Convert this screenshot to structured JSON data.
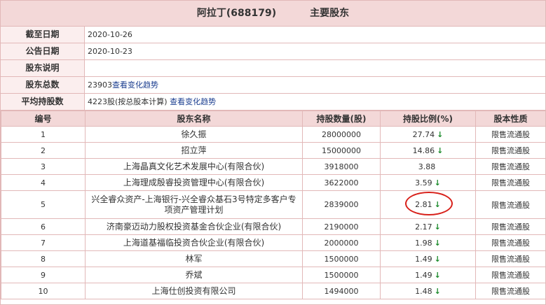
{
  "header": {
    "company": "阿拉丁(688179)",
    "section": "主要股东"
  },
  "info": [
    {
      "label": "截至日期",
      "value": "2020-10-26",
      "link": ""
    },
    {
      "label": "公告日期",
      "value": "2020-10-23",
      "link": ""
    },
    {
      "label": "股东说明",
      "value": "",
      "link": ""
    },
    {
      "label": "股东总数",
      "value": "23903",
      "link": "查看变化趋势"
    },
    {
      "label": "平均持股数",
      "value": "4223股(按总股本计算)",
      "link": "查看变化趋势"
    }
  ],
  "table": {
    "columns": [
      "编号",
      "股东名称",
      "持股数量(股)",
      "持股比例(%)",
      "股本性质"
    ],
    "rows": [
      {
        "no": "1",
        "name": "徐久振",
        "shares": "28000000",
        "pct": "27.74",
        "arrow": "↓",
        "type": "限售流通股"
      },
      {
        "no": "2",
        "name": "招立萍",
        "shares": "15000000",
        "pct": "14.86",
        "arrow": "↓",
        "type": "限售流通股"
      },
      {
        "no": "3",
        "name": "上海晶真文化艺术发展中心(有限合伙)",
        "shares": "3918000",
        "pct": "3.88",
        "arrow": "",
        "type": "限售流通股"
      },
      {
        "no": "4",
        "name": "上海理成殷睿投资管理中心(有限合伙)",
        "shares": "3622000",
        "pct": "3.59",
        "arrow": "↓",
        "type": "限售流通股"
      },
      {
        "no": "5",
        "name": "兴全睿众资产-上海银行-兴全睿众基石3号特定多客户专项资产管理计划",
        "shares": "2839000",
        "pct": "2.81",
        "arrow": "↓",
        "type": "限售流通股"
      },
      {
        "no": "6",
        "name": "济南豪迈动力股权投资基金合伙企业(有限合伙)",
        "shares": "2190000",
        "pct": "2.17",
        "arrow": "↓",
        "type": "限售流通股"
      },
      {
        "no": "7",
        "name": "上海道基福临投资合伙企业(有限合伙)",
        "shares": "2000000",
        "pct": "1.98",
        "arrow": "↓",
        "type": "限售流通股"
      },
      {
        "no": "8",
        "name": "林军",
        "shares": "1500000",
        "pct": "1.49",
        "arrow": "↓",
        "type": "限售流通股"
      },
      {
        "no": "9",
        "name": "乔斌",
        "shares": "1500000",
        "pct": "1.49",
        "arrow": "↓",
        "type": "限售流通股"
      },
      {
        "no": "10",
        "name": "上海仕创投资有限公司",
        "shares": "1494000",
        "pct": "1.48",
        "arrow": "↓",
        "type": "限售流通股"
      }
    ]
  },
  "colors": {
    "header_bg": "#f3d8d8",
    "border": "#e2b8b8",
    "link": "#1a3d8f",
    "down_arrow": "#1a8a2a",
    "highlight": "#d8201a"
  }
}
